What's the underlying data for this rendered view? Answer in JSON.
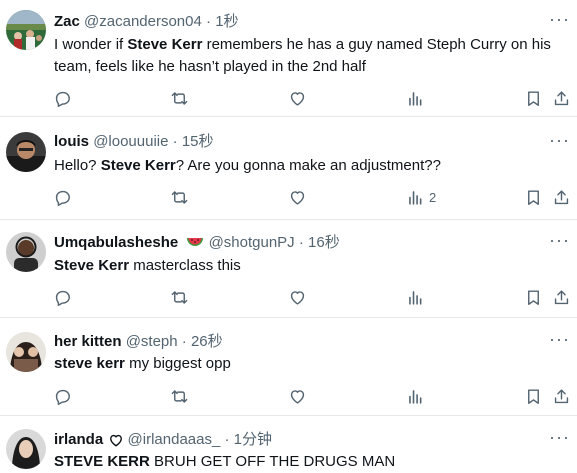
{
  "tweets": [
    {
      "name": "Zac",
      "handle": "@zacanderson04",
      "time": "1秒",
      "text_pre": "I wonder if ",
      "text_bold": "Steve Kerr",
      "text_post": " remembers he has a guy named Steph Curry on his team, feels like he hasn’t played in the 2nd half",
      "views": ""
    },
    {
      "name": "louis",
      "handle": "@loouuuiie",
      "time": "15秒",
      "text_pre": "Hello? ",
      "text_bold": "Steve Kerr",
      "text_post": "? Are you gonna make an adjustment??",
      "views": "2"
    },
    {
      "name": "Umqabulasheshe",
      "handle": "@shotgunPJ",
      "time": "16秒",
      "text_pre": "",
      "text_bold": "Steve Kerr",
      "text_post": " masterclass this",
      "views": ""
    },
    {
      "name": "her kitten",
      "handle": "@steph",
      "time": "26秒",
      "text_pre": "",
      "text_bold": "steve kerr",
      "text_post": " my biggest opp",
      "views": ""
    },
    {
      "name": "irlanda",
      "handle": "@irlandaaas_",
      "time": "1分钟",
      "text_pre": "",
      "text_bold": "STEVE KERR",
      "text_post": " BRUH GET OFF THE DRUGS MAN",
      "views": ""
    }
  ],
  "separator": "·",
  "more_glyph": "···",
  "icons": [
    "reply-icon",
    "retweet-icon",
    "like-icon",
    "views-icon",
    "bookmark-icon",
    "share-icon",
    "watermelon-emoji-icon",
    "heart-outline-icon"
  ]
}
